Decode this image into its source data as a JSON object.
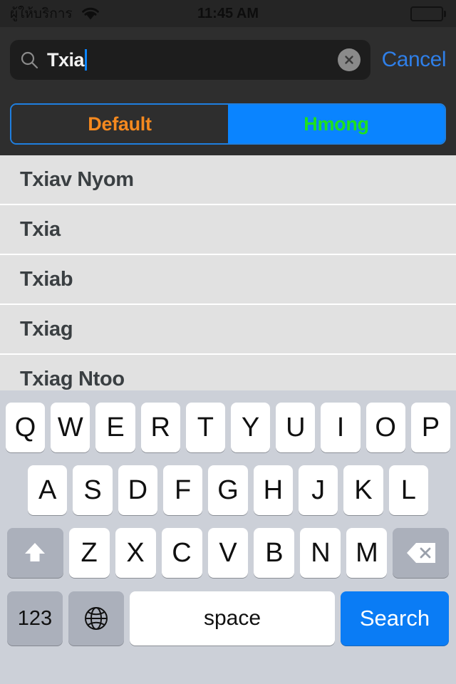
{
  "status_bar": {
    "carrier": "ผู้ให้บริการ",
    "wifi_icon": "wifi-icon",
    "time": "11:45 AM",
    "battery_icon": "battery-full-icon"
  },
  "search": {
    "icon": "search-icon",
    "value": "Txia",
    "placeholder": "Search",
    "clear_icon": "clear-circle-icon",
    "cancel_label": "Cancel",
    "cancel_color": "#2f7fe8",
    "caret_color": "#0a84ff"
  },
  "segmented_control": {
    "border_color": "#1f7fe0",
    "selected_index": 1,
    "segments": [
      {
        "label": "Default",
        "text_color": "#f5891f",
        "selected": false
      },
      {
        "label": "Hmong",
        "text_color": "#1ee11e",
        "selected": true
      }
    ]
  },
  "results": {
    "rows": [
      {
        "label": "Txiav Nyom"
      },
      {
        "label": "Txia"
      },
      {
        "label": "Txiab"
      },
      {
        "label": "Txiag"
      },
      {
        "label": "Txiag Ntoo"
      }
    ]
  },
  "keyboard": {
    "background": "#ccd0d8",
    "row1": [
      "Q",
      "W",
      "E",
      "R",
      "T",
      "Y",
      "U",
      "I",
      "O",
      "P"
    ],
    "row2": [
      "A",
      "S",
      "D",
      "F",
      "G",
      "H",
      "J",
      "K",
      "L"
    ],
    "row3_letters": [
      "Z",
      "X",
      "C",
      "V",
      "B",
      "N",
      "M"
    ],
    "shift_icon": "shift-arrow-up-icon",
    "delete_icon": "backspace-delete-icon",
    "numbers_label": "123",
    "globe_icon": "globe-language-icon",
    "space_label": "space",
    "search_label": "Search",
    "search_key_color": "#0a7cf5"
  }
}
